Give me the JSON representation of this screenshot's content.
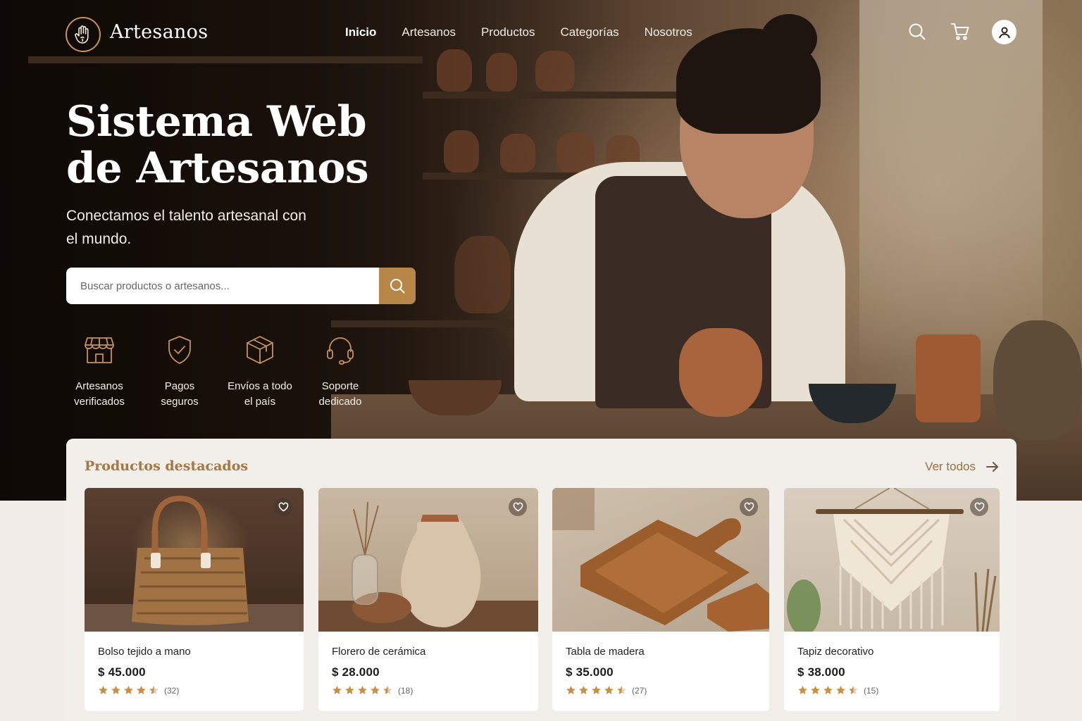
{
  "brand": {
    "name": "Artesanos",
    "accent": "#b88646",
    "title_color": "#a8763e"
  },
  "nav": {
    "items": [
      {
        "label": "Inicio",
        "active": true
      },
      {
        "label": "Artesanos",
        "active": false
      },
      {
        "label": "Productos",
        "active": false
      },
      {
        "label": "Categorías",
        "active": false
      },
      {
        "label": "Nosotros",
        "active": false
      }
    ]
  },
  "header_icons": [
    "search-icon",
    "cart-icon",
    "user-icon"
  ],
  "hero": {
    "title_line1": "Sistema Web",
    "title_line2": "de Artesanos",
    "subtitle": "Conectamos el talento artesanal con el mundo."
  },
  "search": {
    "placeholder": "Buscar productos o artesanos...",
    "value": ""
  },
  "features": [
    {
      "icon": "store-icon",
      "line1": "Artesanos",
      "line2": "verificados"
    },
    {
      "icon": "shield-check-icon",
      "line1": "Pagos",
      "line2": "seguros"
    },
    {
      "icon": "box-icon",
      "line1": "Envíos a todo",
      "line2": "el país"
    },
    {
      "icon": "headset-icon",
      "line1": "Soporte",
      "line2": "dedicado"
    }
  ],
  "featured": {
    "title": "Productos destacados",
    "see_all": "Ver todos",
    "products": [
      {
        "name": "Bolso tejido a mano",
        "price": "$ 45.000",
        "rating": 4.5,
        "reviews": "(32)"
      },
      {
        "name": "Florero de cerámica",
        "price": "$ 28.000",
        "rating": 4.5,
        "reviews": "(18)"
      },
      {
        "name": "Tabla de madera",
        "price": "$ 35.000",
        "rating": 4.5,
        "reviews": "(27)"
      },
      {
        "name": "Tapiz decorativo",
        "price": "$ 38.000",
        "rating": 4.5,
        "reviews": "(15)"
      }
    ]
  }
}
